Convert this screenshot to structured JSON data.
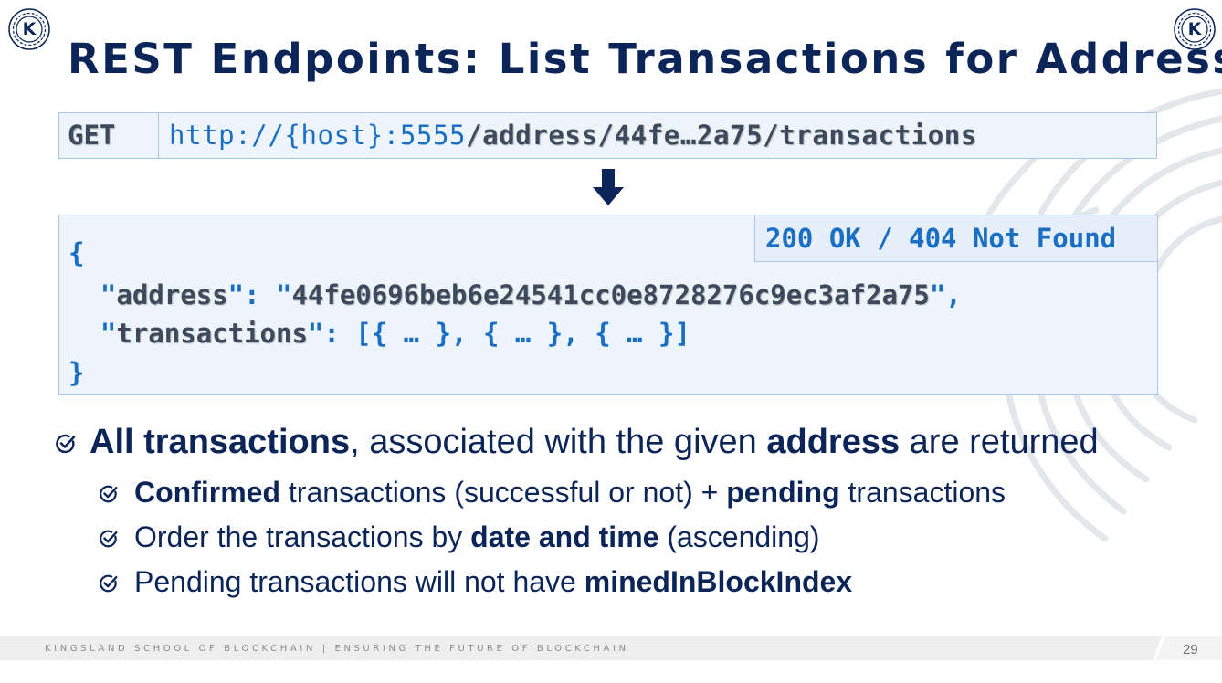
{
  "logo": {
    "letter": "K"
  },
  "title": "REST Endpoints: List Transactions for Address",
  "request": {
    "method": "GET",
    "url_base": "http://{host}:5555",
    "url_path": "/address/44fe…2a75/transactions"
  },
  "response": {
    "status": "200 OK / 404 Not Found",
    "open_brace": "{",
    "close_brace": "}",
    "address_key": "address",
    "address_value": "44fe0696beb6e24541cc0e8728276c9ec3af2a75",
    "transactions_key": "transactions",
    "transactions_value": "[{ … }, { … }, { … }]"
  },
  "bullets": {
    "main": {
      "bold1": "All transactions",
      "text1": ", associated with the given ",
      "bold2": "address",
      "text2": " are returned"
    },
    "sub1": {
      "bold1": "Confirmed",
      "text1": " transactions (successful or not) + ",
      "bold2": "pending",
      "text2": " transactions"
    },
    "sub2": {
      "text1": "Order the transactions by ",
      "bold1": "date and time",
      "text2": " (ascending)"
    },
    "sub3": {
      "text1": "Pending transactions will not have ",
      "bold1": "minedInBlockIndex"
    }
  },
  "footer": {
    "text": "KINGSLAND SCHOOL OF BLOCKCHAIN | ENSURING THE FUTURE OF BLOCKCHAIN",
    "page_number": "29"
  },
  "colors": {
    "title": "#0b2559",
    "accent_blue": "#1a6fc4",
    "code_gray": "#3d4a5c",
    "box_fill": "#eef4fb",
    "box_border": "#a9c7e6"
  },
  "icons": {
    "logo": "kingsland-k-logo",
    "check": "check-circle-icon",
    "arrow": "arrow-down-icon"
  }
}
